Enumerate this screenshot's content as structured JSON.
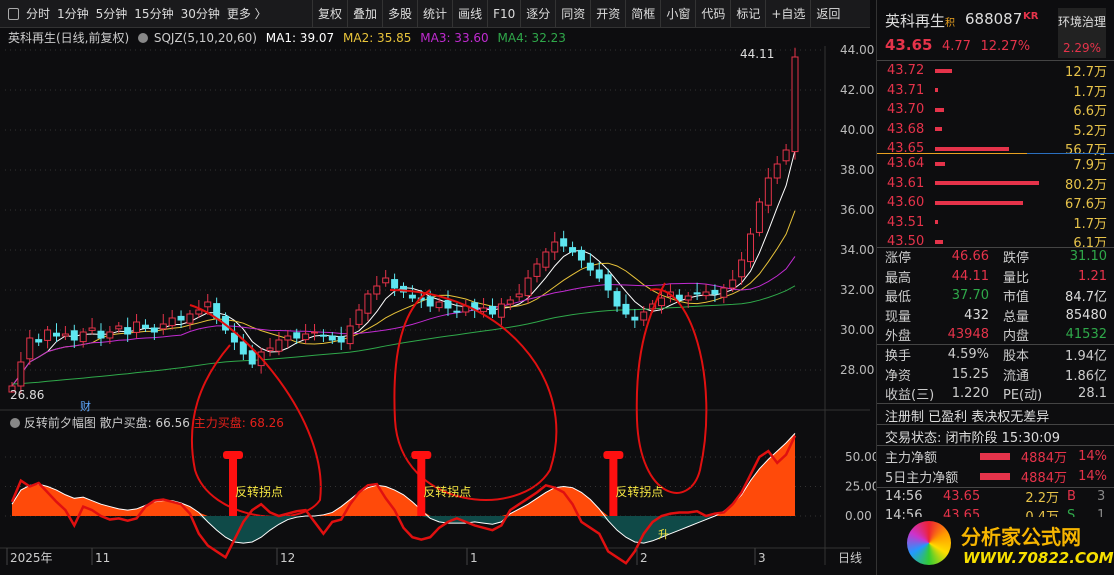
{
  "toolbar": {
    "periods": [
      "分时",
      "1分钟",
      "5分钟",
      "15分钟",
      "30分钟",
      "更多 〉"
    ],
    "buttons": [
      "复权",
      "叠加",
      "多股",
      "统计",
      "画线",
      "F10",
      "逐分",
      "同资",
      "开资",
      "简框",
      "小窗",
      "代码",
      "标记",
      "+自选",
      "返回"
    ]
  },
  "legend": {
    "title": "英科再生(日线,前复权)",
    "indicator": "SQJZ(5,10,20,60)",
    "ma1": "MA1: 39.07",
    "ma2": "MA2: 35.85",
    "ma3": "MA3: 33.60",
    "ma4": "MA4: 32.23"
  },
  "colors": {
    "up": "#e5334a",
    "down": "#5ee6f0",
    "ma1": "#ffffff",
    "ma2": "#e8c33a",
    "ma3": "#c02bd0",
    "ma4": "#2fa84a"
  },
  "chart_data": {
    "type": "candlestick",
    "y_ticks": [
      "44.00",
      "42.00",
      "40.00",
      "38.00",
      "36.00",
      "34.00",
      "32.00",
      "30.00",
      "28.00"
    ],
    "ylim": [
      27.7,
      44.3
    ],
    "closes": [
      27.2,
      28.4,
      29.6,
      29.4,
      30.0,
      29.7,
      29.8,
      29.5,
      29.9,
      30.1,
      29.6,
      29.9,
      30.2,
      29.8,
      30.4,
      30.1,
      29.9,
      30.3,
      30.6,
      30.5,
      30.8,
      31.0,
      31.4,
      30.6,
      30.0,
      29.4,
      28.8,
      28.3,
      28.9,
      29.1,
      29.5,
      29.7,
      29.6,
      29.8,
      29.9,
      29.7,
      29.5,
      29.4,
      30.2,
      31.0,
      31.8,
      32.2,
      32.6,
      32.1,
      31.9,
      31.6,
      31.5,
      31.2,
      31.4,
      31.1,
      30.9,
      31.2,
      31.0,
      31.1,
      30.8,
      31.3,
      31.5,
      31.8,
      32.6,
      33.3,
      33.9,
      34.4,
      34.2,
      33.9,
      33.5,
      33.0,
      32.6,
      32.0,
      31.2,
      30.8,
      30.5,
      30.9,
      31.3,
      31.6,
      31.9,
      31.5,
      31.7,
      31.8,
      31.9,
      31.8,
      32.1,
      32.5,
      33.5,
      34.8,
      36.4,
      37.6,
      38.3,
      39.0,
      43.65
    ],
    "high_label": "44.11",
    "low_label": "26.86",
    "marker": "财",
    "x_labels": [
      "2025年",
      "11",
      "12",
      "1",
      "2",
      "3"
    ],
    "period_label": "日线"
  },
  "indicator": {
    "name": "反转前夕幅图",
    "retail": "散户买盘: 66.56",
    "main": "主力买盘: 68.26",
    "y_ticks": [
      "50.00",
      "25.00",
      "0.00"
    ],
    "signal_label": "反转拐点",
    "rise_mark": "升",
    "area": [
      10,
      22,
      26,
      27,
      25,
      22,
      18,
      15,
      16,
      13,
      10,
      8,
      6,
      5,
      6,
      9,
      12,
      13,
      13,
      11,
      8,
      3,
      -5,
      -12,
      -18,
      -22,
      -23,
      -22,
      -18,
      -12,
      -7,
      -3,
      -1,
      0,
      0,
      1,
      3,
      8,
      14,
      20,
      24,
      26,
      25,
      22,
      18,
      12,
      5,
      -2,
      -5,
      -6,
      -6,
      -6,
      -5,
      -6,
      -7,
      -5,
      2,
      6,
      10,
      15,
      20,
      24,
      25,
      24,
      20,
      14,
      6,
      -4,
      -12,
      -18,
      -22,
      -23,
      -21,
      -18,
      -15,
      -12,
      -9,
      -6,
      -3,
      0,
      4,
      10,
      18,
      30,
      40,
      48,
      55,
      62,
      70
    ],
    "line": [
      12,
      30,
      25,
      28,
      20,
      12,
      5,
      -8,
      8,
      5,
      0,
      -3,
      -2,
      -4,
      -2,
      8,
      13,
      14,
      12,
      10,
      2,
      -15,
      -25,
      -30,
      -35,
      -20,
      -5,
      5,
      10,
      3,
      0,
      2,
      4,
      5,
      -5,
      -15,
      -5,
      -3,
      10,
      20,
      26,
      27,
      15,
      5,
      -10,
      -18,
      -20,
      -18,
      -10,
      -5,
      -2,
      -5,
      -8,
      -10,
      -12,
      -8,
      5,
      10,
      15,
      20,
      26,
      24,
      20,
      10,
      -5,
      -10,
      -15,
      -30,
      -35,
      -40,
      -30,
      -15,
      -5,
      0,
      2,
      3,
      3,
      4,
      0,
      2,
      3,
      10,
      20,
      35,
      50,
      55,
      45,
      52,
      68
    ]
  },
  "signals": [
    27,
    50,
    72
  ],
  "quote": {
    "name": "英科再生",
    "tag": "积",
    "code": "688087",
    "kr": "KR",
    "price": "43.65",
    "change": "4.77",
    "pct": "12.27%",
    "sector": "环境治理",
    "sector_pct": "2.29%"
  },
  "asks": [
    {
      "p": "43.72",
      "v": "12.7万",
      "n": 12.7
    },
    {
      "p": "43.71",
      "v": "1.7万",
      "n": 1.7
    },
    {
      "p": "43.70",
      "v": "6.6万",
      "n": 6.6
    },
    {
      "p": "43.68",
      "v": "5.2万",
      "n": 5.2
    },
    {
      "p": "43.65",
      "v": "56.7万",
      "n": 56.7
    }
  ],
  "bids": [
    {
      "p": "43.64",
      "v": "7.9万",
      "n": 7.9
    },
    {
      "p": "43.61",
      "v": "80.2万",
      "n": 80.2
    },
    {
      "p": "43.60",
      "v": "67.6万",
      "n": 67.6
    },
    {
      "p": "43.51",
      "v": "1.7万",
      "n": 1.7
    },
    {
      "p": "43.50",
      "v": "6.1万",
      "n": 6.1
    }
  ],
  "stats": [
    [
      "涨停",
      "46.66",
      "red",
      "跌停",
      "31.10",
      "grn"
    ],
    [
      "最高",
      "44.11",
      "red",
      "量比",
      "1.21",
      "red"
    ],
    [
      "最低",
      "37.70",
      "grn",
      "市值",
      "84.7亿",
      "wht"
    ],
    [
      "现量",
      "432",
      "wht",
      "总量",
      "85480",
      "wht"
    ],
    [
      "外盘",
      "43948",
      "red",
      "内盘",
      "41532",
      "grn"
    ]
  ],
  "stats2": [
    [
      "换手",
      "4.59%",
      "股本",
      "1.94亿"
    ],
    [
      "净资",
      "15.25",
      "流通",
      "1.86亿"
    ],
    [
      "收益(三)",
      "1.220",
      "PE(动)",
      "28.1"
    ]
  ],
  "tags": "注册制 已盈利 表决权无差异",
  "status": "交易状态: 闭市阶段 15:30:09",
  "flow": [
    {
      "label": "主力净额",
      "amt": "4884万",
      "pct": "14%"
    },
    {
      "label": "5日主力净额",
      "amt": "4884万",
      "pct": "14%"
    }
  ],
  "ticks": [
    {
      "t": "14:56",
      "p": "43.65",
      "v": "2.2万",
      "s": "B",
      "n": "3"
    },
    {
      "t": "14:56",
      "p": "43.65",
      "v": "0.4万",
      "s": "S",
      "n": "1"
    }
  ],
  "watermark": {
    "site": "分析家公式网",
    "url": "WWW.70822.COM"
  }
}
